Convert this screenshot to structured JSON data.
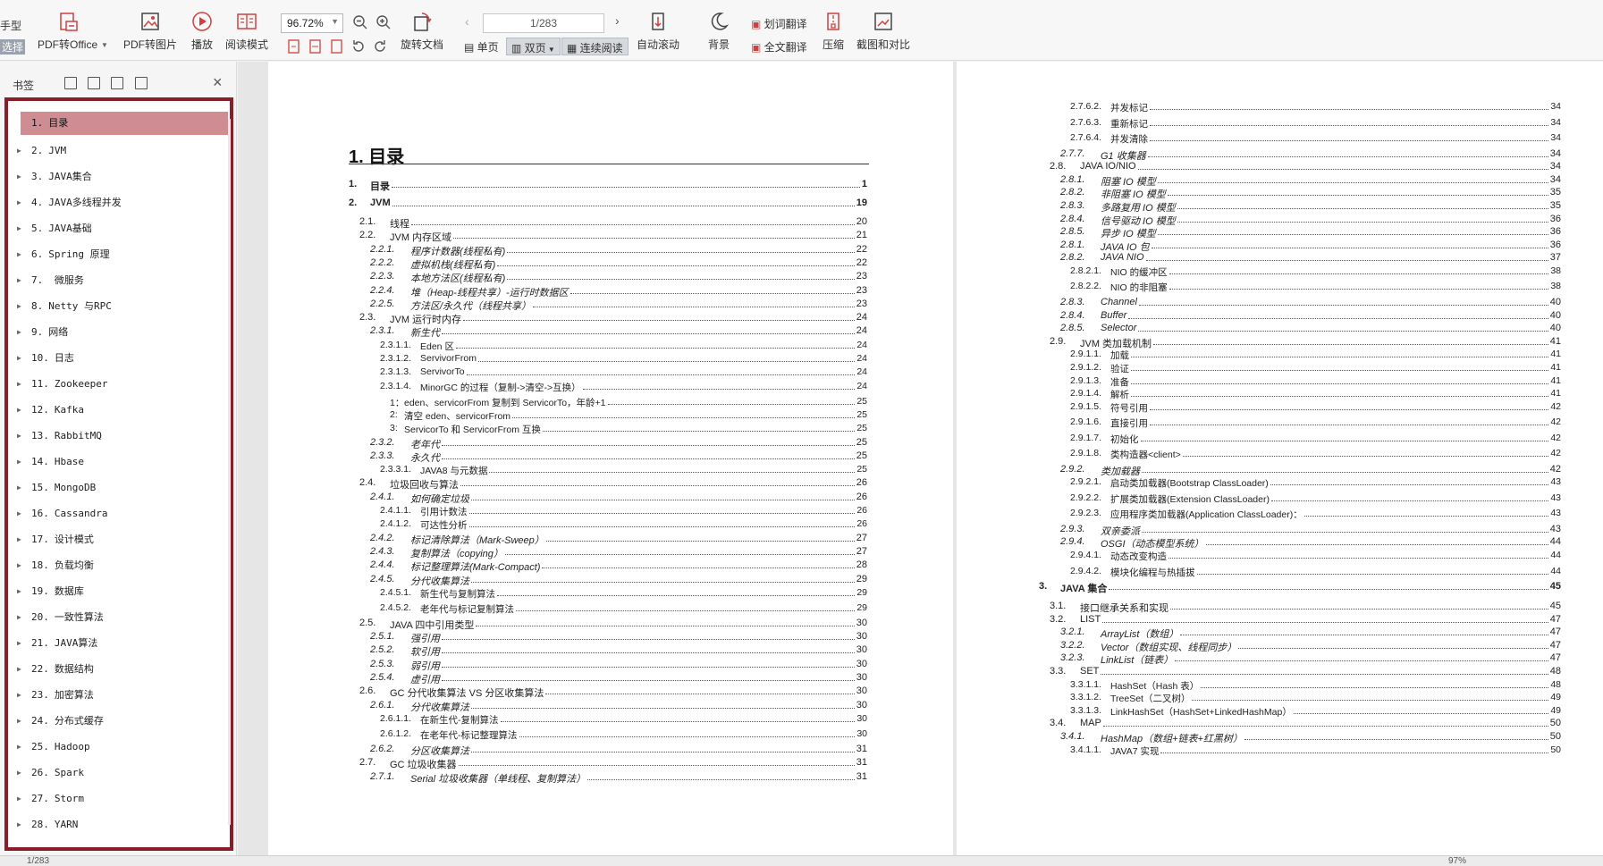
{
  "toolbar": {
    "cut_label_1": "手型",
    "cut_label_2": "选择",
    "pdf_to_office": "PDF转Office",
    "pdf_to_image": "PDF转图片",
    "play": "播放",
    "read_mode": "阅读模式",
    "zoom": "96.72%",
    "rotate_doc": "旋转文档",
    "page_input": "1/283",
    "single_page": "单页",
    "double_page": "双页",
    "continuous": "连续阅读",
    "auto_scroll": "自动滚动",
    "background": "背景",
    "word_translate": "划词翻译",
    "full_translate": "全文翻译",
    "compress": "压缩",
    "screenshot_compare": "截图和对比"
  },
  "bookmarks": {
    "header": "书签",
    "items": [
      {
        "num": "1.",
        "label": "目录"
      },
      {
        "num": "2.",
        "label": "JVM"
      },
      {
        "num": "3.",
        "label": "JAVA集合"
      },
      {
        "num": "4.",
        "label": "JAVA多线程并发"
      },
      {
        "num": "5.",
        "label": "JAVA基础"
      },
      {
        "num": "6.",
        "label": "Spring 原理"
      },
      {
        "num": "7.",
        "label": "  微服务"
      },
      {
        "num": "8.",
        "label": "Netty 与RPC"
      },
      {
        "num": "9.",
        "label": "网络"
      },
      {
        "num": "10.",
        "label": "日志"
      },
      {
        "num": "11.",
        "label": "Zookeeper"
      },
      {
        "num": "12.",
        "label": "Kafka"
      },
      {
        "num": "13.",
        "label": "RabbitMQ"
      },
      {
        "num": "14.",
        "label": "Hbase"
      },
      {
        "num": "15.",
        "label": "MongoDB"
      },
      {
        "num": "16.",
        "label": "Cassandra"
      },
      {
        "num": "17.",
        "label": "设计模式"
      },
      {
        "num": "18.",
        "label": "负载均衡"
      },
      {
        "num": "19.",
        "label": "数据库"
      },
      {
        "num": "20.",
        "label": "一致性算法"
      },
      {
        "num": "21.",
        "label": "JAVA算法"
      },
      {
        "num": "22.",
        "label": "数据结构"
      },
      {
        "num": "23.",
        "label": "加密算法"
      },
      {
        "num": "24.",
        "label": "分布式缓存"
      },
      {
        "num": "25.",
        "label": "Hadoop"
      },
      {
        "num": "26.",
        "label": "Spark"
      },
      {
        "num": "27.",
        "label": "Storm"
      },
      {
        "num": "28.",
        "label": "YARN"
      }
    ]
  },
  "page_left": {
    "title": "1. 目录",
    "rows": [
      {
        "n": "1.",
        "t": "目录",
        "p": "1",
        "lvl": 0,
        "style": "bold"
      },
      {
        "n": "2.",
        "t": "JVM",
        "p": "19",
        "lvl": 0,
        "style": "bold"
      },
      {
        "n": "2.1.",
        "t": "线程",
        "p": "20",
        "lvl": 1,
        "style": ""
      },
      {
        "n": "2.2.",
        "t": "JVM 内存区域",
        "p": "21",
        "lvl": 1,
        "style": ""
      },
      {
        "n": "2.2.1.",
        "t": "程序计数器(线程私有)",
        "p": "22",
        "lvl": 2,
        "style": "it"
      },
      {
        "n": "2.2.2.",
        "t": "虚拟机栈(线程私有)",
        "p": "22",
        "lvl": 2,
        "style": "it"
      },
      {
        "n": "2.2.3.",
        "t": "本地方法区(线程私有)",
        "p": "23",
        "lvl": 2,
        "style": "it"
      },
      {
        "n": "2.2.4.",
        "t": "堆（Heap-线程共享）-运行时数据区",
        "p": "23",
        "lvl": 2,
        "style": "it"
      },
      {
        "n": "2.2.5.",
        "t": "方法区/永久代（线程共享）",
        "p": "23",
        "lvl": 2,
        "style": "it"
      },
      {
        "n": "2.3.",
        "t": "JVM 运行时内存",
        "p": "24",
        "lvl": 1,
        "style": ""
      },
      {
        "n": "2.3.1.",
        "t": "新生代",
        "p": "24",
        "lvl": 2,
        "style": "it"
      },
      {
        "n": "2.3.1.1.",
        "t": "Eden 区",
        "p": "24",
        "lvl": 3,
        "style": ""
      },
      {
        "n": "2.3.1.2.",
        "t": "ServivorFrom",
        "p": "24",
        "lvl": 3,
        "style": ""
      },
      {
        "n": "2.3.1.3.",
        "t": "ServivorTo",
        "p": "24",
        "lvl": 3,
        "style": ""
      },
      {
        "n": "2.3.1.4.",
        "t": "MinorGC 的过程（复制->清空->互换）",
        "p": "24",
        "lvl": 3,
        "style": ""
      },
      {
        "n": "1：",
        "t": "eden、servicorFrom 复制到 ServicorTo，年龄+1",
        "p": "25",
        "lvl": 4,
        "style": ""
      },
      {
        "n": "2:",
        "t": "清空 eden、servicorFrom",
        "p": "25",
        "lvl": 4,
        "style": ""
      },
      {
        "n": "3:",
        "t": "ServicorTo 和 ServicorFrom 互换",
        "p": "25",
        "lvl": 4,
        "style": ""
      },
      {
        "n": "2.3.2.",
        "t": "老年代",
        "p": "25",
        "lvl": 2,
        "style": "it"
      },
      {
        "n": "2.3.3.",
        "t": "永久代",
        "p": "25",
        "lvl": 2,
        "style": "it"
      },
      {
        "n": "2.3.3.1.",
        "t": "JAVA8 与元数据",
        "p": "25",
        "lvl": 3,
        "style": ""
      },
      {
        "n": "2.4.",
        "t": "垃圾回收与算法",
        "p": "26",
        "lvl": 1,
        "style": ""
      },
      {
        "n": "2.4.1.",
        "t": "如何确定垃圾",
        "p": "26",
        "lvl": 2,
        "style": "it"
      },
      {
        "n": "2.4.1.1.",
        "t": "引用计数法",
        "p": "26",
        "lvl": 3,
        "style": ""
      },
      {
        "n": "2.4.1.2.",
        "t": "可达性分析",
        "p": "26",
        "lvl": 3,
        "style": ""
      },
      {
        "n": "2.4.2.",
        "t": "标记清除算法（Mark-Sweep）",
        "p": "27",
        "lvl": 2,
        "style": "it"
      },
      {
        "n": "2.4.3.",
        "t": "复制算法（copying）",
        "p": "27",
        "lvl": 2,
        "style": "it"
      },
      {
        "n": "2.4.4.",
        "t": "标记整理算法(Mark-Compact)",
        "p": "28",
        "lvl": 2,
        "style": "it"
      },
      {
        "n": "2.4.5.",
        "t": "分代收集算法",
        "p": "29",
        "lvl": 2,
        "style": "it"
      },
      {
        "n": "2.4.5.1.",
        "t": "新生代与复制算法",
        "p": "29",
        "lvl": 3,
        "style": ""
      },
      {
        "n": "2.4.5.2.",
        "t": "老年代与标记复制算法",
        "p": "29",
        "lvl": 3,
        "style": ""
      },
      {
        "n": "2.5.",
        "t": "JAVA 四中引用类型",
        "p": "30",
        "lvl": 1,
        "style": ""
      },
      {
        "n": "2.5.1.",
        "t": "强引用",
        "p": "30",
        "lvl": 2,
        "style": "it"
      },
      {
        "n": "2.5.2.",
        "t": "软引用",
        "p": "30",
        "lvl": 2,
        "style": "it"
      },
      {
        "n": "2.5.3.",
        "t": "弱引用",
        "p": "30",
        "lvl": 2,
        "style": "it"
      },
      {
        "n": "2.5.4.",
        "t": "虚引用",
        "p": "30",
        "lvl": 2,
        "style": "it"
      },
      {
        "n": "2.6.",
        "t": "GC 分代收集算法 VS 分区收集算法",
        "p": "30",
        "lvl": 1,
        "style": ""
      },
      {
        "n": "2.6.1.",
        "t": "分代收集算法",
        "p": "30",
        "lvl": 2,
        "style": "it"
      },
      {
        "n": "2.6.1.1.",
        "t": "在新生代-复制算法",
        "p": "30",
        "lvl": 3,
        "style": ""
      },
      {
        "n": "2.6.1.2.",
        "t": "在老年代-标记整理算法",
        "p": "30",
        "lvl": 3,
        "style": ""
      },
      {
        "n": "2.6.2.",
        "t": "分区收集算法",
        "p": "31",
        "lvl": 2,
        "style": "it"
      },
      {
        "n": "2.7.",
        "t": "GC 垃圾收集器",
        "p": "31",
        "lvl": 1,
        "style": ""
      },
      {
        "n": "2.7.1.",
        "t": "Serial 垃圾收集器（单线程、复制算法）",
        "p": "31",
        "lvl": 2,
        "style": "it"
      }
    ]
  },
  "page_right": {
    "rows": [
      {
        "n": "2.7.6.2.",
        "t": "并发标记",
        "p": "34",
        "lvl": 3,
        "style": ""
      },
      {
        "n": "2.7.6.3.",
        "t": "重新标记",
        "p": "34",
        "lvl": 3,
        "style": ""
      },
      {
        "n": "2.7.6.4.",
        "t": "并发清除",
        "p": "34",
        "lvl": 3,
        "style": ""
      },
      {
        "n": "2.7.7.",
        "t": "G1 收集器",
        "p": "34",
        "lvl": 2,
        "style": "it"
      },
      {
        "n": "2.8.",
        "t": "JAVA IO/NIO",
        "p": "34",
        "lvl": 1,
        "style": ""
      },
      {
        "n": "2.8.1.",
        "t": "阻塞 IO 模型",
        "p": "34",
        "lvl": 2,
        "style": "it"
      },
      {
        "n": "2.8.2.",
        "t": "非阻塞 IO 模型",
        "p": "35",
        "lvl": 2,
        "style": "it"
      },
      {
        "n": "2.8.3.",
        "t": "多路复用 IO 模型",
        "p": "35",
        "lvl": 2,
        "style": "it"
      },
      {
        "n": "2.8.4.",
        "t": "信号驱动 IO 模型",
        "p": "36",
        "lvl": 2,
        "style": "it"
      },
      {
        "n": "2.8.5.",
        "t": "异步 IO 模型",
        "p": "36",
        "lvl": 2,
        "style": "it"
      },
      {
        "n": "2.8.1.",
        "t": "JAVA IO 包",
        "p": "36",
        "lvl": 2,
        "style": "it"
      },
      {
        "n": "2.8.2.",
        "t": "JAVA NIO",
        "p": "37",
        "lvl": 2,
        "style": "it"
      },
      {
        "n": "2.8.2.1.",
        "t": "NIO 的缓冲区",
        "p": "38",
        "lvl": 3,
        "style": ""
      },
      {
        "n": "2.8.2.2.",
        "t": "NIO 的非阻塞",
        "p": "38",
        "lvl": 3,
        "style": ""
      },
      {
        "n": "2.8.3.",
        "t": "Channel",
        "p": "40",
        "lvl": 2,
        "style": "it"
      },
      {
        "n": "2.8.4.",
        "t": "Buffer",
        "p": "40",
        "lvl": 2,
        "style": "it"
      },
      {
        "n": "2.8.5.",
        "t": "Selector",
        "p": "40",
        "lvl": 2,
        "style": "it"
      },
      {
        "n": "2.9.",
        "t": "JVM 类加载机制",
        "p": "41",
        "lvl": 1,
        "style": ""
      },
      {
        "n": "2.9.1.1.",
        "t": "加载",
        "p": "41",
        "lvl": 3,
        "style": ""
      },
      {
        "n": "2.9.1.2.",
        "t": "验证",
        "p": "41",
        "lvl": 3,
        "style": ""
      },
      {
        "n": "2.9.1.3.",
        "t": "准备",
        "p": "41",
        "lvl": 3,
        "style": ""
      },
      {
        "n": "2.9.1.4.",
        "t": "解析",
        "p": "41",
        "lvl": 3,
        "style": ""
      },
      {
        "n": "2.9.1.5.",
        "t": "符号引用",
        "p": "42",
        "lvl": 3,
        "style": ""
      },
      {
        "n": "2.9.1.6.",
        "t": "直接引用",
        "p": "42",
        "lvl": 3,
        "style": ""
      },
      {
        "n": "2.9.1.7.",
        "t": "初始化",
        "p": "42",
        "lvl": 3,
        "style": ""
      },
      {
        "n": "2.9.1.8.",
        "t": "类构造器<client>",
        "p": "42",
        "lvl": 3,
        "style": ""
      },
      {
        "n": "2.9.2.",
        "t": "类加载器",
        "p": "42",
        "lvl": 2,
        "style": "it"
      },
      {
        "n": "2.9.2.1.",
        "t": "启动类加载器(Bootstrap ClassLoader)",
        "p": "43",
        "lvl": 3,
        "style": ""
      },
      {
        "n": "2.9.2.2.",
        "t": "扩展类加载器(Extension ClassLoader)",
        "p": "43",
        "lvl": 3,
        "style": ""
      },
      {
        "n": "2.9.2.3.",
        "t": "应用程序类加载器(Application ClassLoader)：",
        "p": "43",
        "lvl": 3,
        "style": ""
      },
      {
        "n": "2.9.3.",
        "t": "双亲委派",
        "p": "43",
        "lvl": 2,
        "style": "it"
      },
      {
        "n": "2.9.4.",
        "t": "OSGI（动态模型系统）",
        "p": "44",
        "lvl": 2,
        "style": "it"
      },
      {
        "n": "2.9.4.1.",
        "t": "动态改变构造",
        "p": "44",
        "lvl": 3,
        "style": ""
      },
      {
        "n": "2.9.4.2.",
        "t": "模块化编程与热插拔",
        "p": "44",
        "lvl": 3,
        "style": ""
      },
      {
        "n": "3.",
        "t": "JAVA 集合",
        "p": "45",
        "lvl": 0,
        "style": "bold"
      },
      {
        "n": "3.1.",
        "t": "接口继承关系和实现",
        "p": "45",
        "lvl": 1,
        "style": ""
      },
      {
        "n": "3.2.",
        "t": "LIST",
        "p": "47",
        "lvl": 1,
        "style": ""
      },
      {
        "n": "3.2.1.",
        "t": "ArrayList（数组）",
        "p": "47",
        "lvl": 2,
        "style": "it"
      },
      {
        "n": "3.2.2.",
        "t": "Vector（数组实现、线程同步）",
        "p": "47",
        "lvl": 2,
        "style": "it"
      },
      {
        "n": "3.2.3.",
        "t": "LinkList（链表）",
        "p": "47",
        "lvl": 2,
        "style": "it"
      },
      {
        "n": "3.3.",
        "t": "SET",
        "p": "48",
        "lvl": 1,
        "style": ""
      },
      {
        "n": "3.3.1.1.",
        "t": "HashSet（Hash 表）",
        "p": "48",
        "lvl": 3,
        "style": ""
      },
      {
        "n": "3.3.1.2.",
        "t": "TreeSet（二叉树）",
        "p": "49",
        "lvl": 3,
        "style": ""
      },
      {
        "n": "3.3.1.3.",
        "t": "LinkHashSet（HashSet+LinkedHashMap）",
        "p": "49",
        "lvl": 3,
        "style": ""
      },
      {
        "n": "3.4.",
        "t": "MAP",
        "p": "50",
        "lvl": 1,
        "style": ""
      },
      {
        "n": "3.4.1.",
        "t": "HashMap（数组+链表+红黑树）",
        "p": "50",
        "lvl": 2,
        "style": "it"
      },
      {
        "n": "3.4.1.1.",
        "t": "JAVA7 实现",
        "p": "50",
        "lvl": 3,
        "style": ""
      }
    ]
  },
  "statusbar": {
    "page": "1/283",
    "zoom": "97%"
  }
}
